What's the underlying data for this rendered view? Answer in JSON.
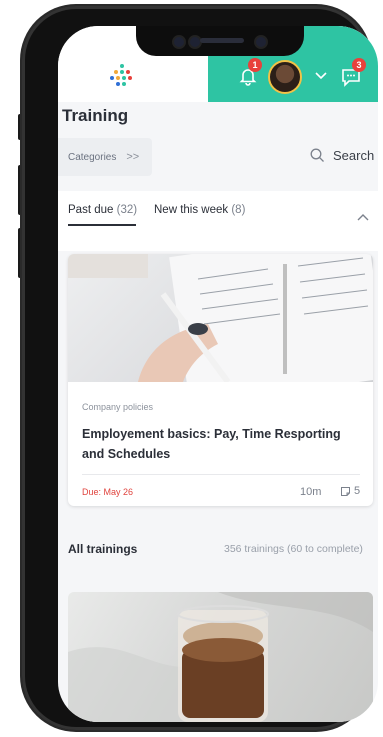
{
  "header": {
    "notifications_count": "1",
    "messages_count": "3",
    "brand_colors": {
      "accent": "#2ec4a3",
      "badge": "#e8413c"
    }
  },
  "page": {
    "title": "Training"
  },
  "filters": {
    "categories_label": "Categories",
    "categories_arrow": ">>",
    "search_label": "Search"
  },
  "tabs": [
    {
      "label": "Past due",
      "count": "(32)"
    },
    {
      "label": "New this week",
      "count": "(8)"
    }
  ],
  "featured_card": {
    "category": "Company policies",
    "title": "Employement basics: Pay, Time Resporting and Schedules",
    "due": "Due: May 26",
    "duration": "10m",
    "lessons": "5"
  },
  "all_trainings": {
    "title": "All trainings",
    "count_text": "356 trainings (60 to complete)"
  },
  "icons": [
    "logo-icon",
    "bell-icon",
    "chevron-down-icon",
    "chat-icon",
    "search-icon",
    "chevron-up-icon",
    "lessons-icon"
  ]
}
